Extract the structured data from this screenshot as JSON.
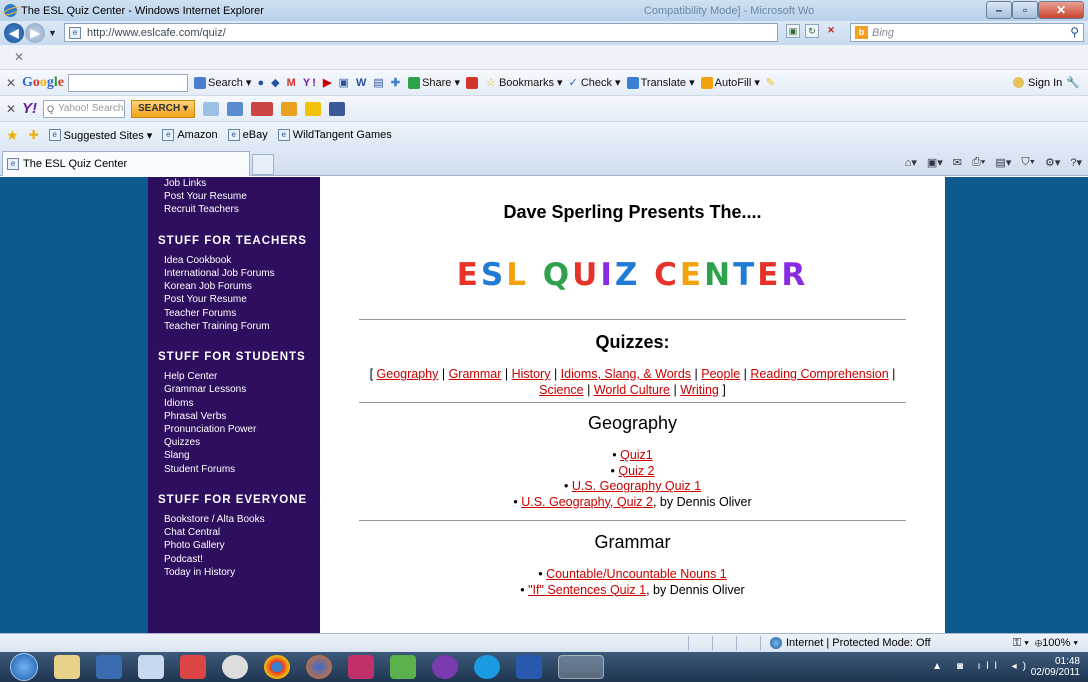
{
  "window": {
    "title": "The ESL Quiz Center - Windows Internet Explorer",
    "ghost_title": "Compatibility Mode] - Microsoft Wo"
  },
  "address": {
    "url": "http://www.eslcafe.com/quiz/",
    "search_placeholder": "Bing"
  },
  "google_toolbar": {
    "logo": [
      "G",
      "o",
      "o",
      "g",
      "l",
      "e"
    ],
    "items": [
      "Search ▾",
      "Share ▾",
      "Bookmarks ▾",
      "Check ▾",
      "Translate ▾",
      "AutoFill ▾"
    ],
    "sign_in": "Sign In"
  },
  "yahoo_toolbar": {
    "logo": "Y!",
    "search_placeholder": "Yahoo! Search",
    "search_button": "SEARCH ▾"
  },
  "favorites": {
    "items": [
      "Suggested Sites ▾",
      "Amazon",
      "eBay",
      "WildTangent Games"
    ]
  },
  "tab": {
    "label": "The ESL Quiz Center"
  },
  "sidebar": {
    "top_links": [
      "Job Links",
      "Post Your Resume",
      "Recruit Teachers"
    ],
    "sections": [
      {
        "title": "STUFF FOR TEACHERS",
        "links": [
          "Idea Cookbook",
          "International Job Forums",
          "Korean Job Forums",
          "Post Your Resume",
          "Teacher Forums",
          "Teacher Training Forum"
        ]
      },
      {
        "title": "STUFF FOR STUDENTS",
        "links": [
          "Help Center",
          "Grammar Lessons",
          "Idioms",
          "Phrasal Verbs",
          "Pronunciation Power",
          "Quizzes",
          "Slang",
          "Student Forums"
        ]
      },
      {
        "title": "STUFF FOR EVERYONE",
        "links": [
          "Bookstore / Alta Books",
          "Chat Central",
          "Photo Gallery",
          "Podcast!",
          "Today in History"
        ]
      }
    ]
  },
  "main": {
    "heading": "Dave Sperling Presents The....",
    "logo_letters": [
      "E",
      "S",
      "L",
      " ",
      "Q",
      "U",
      "I",
      "Z",
      " ",
      "C",
      "E",
      "N",
      "T",
      "E",
      "R"
    ],
    "logo_colors": [
      "#e6332a",
      "#1f7bd6",
      "#f2a20c",
      "#ffffff",
      "#2ea24a",
      "#e6332a",
      "#8a2be2",
      "#1f7bd6",
      "#ffffff",
      "#e6332a",
      "#f2a20c",
      "#2ea24a",
      "#1f7bd6",
      "#e6332a",
      "#8a2be2"
    ],
    "quizzes_title": "Quizzes:",
    "categories": [
      "Geography",
      "Grammar",
      "History",
      "Idioms, Slang, & Words",
      "People",
      "Reading Comprehension",
      "Science",
      "World Culture",
      "Writing"
    ],
    "geography_title": "Geography",
    "geography_items": [
      {
        "link": "Quiz1",
        "suffix": ""
      },
      {
        "link": "Quiz 2",
        "suffix": ""
      },
      {
        "link": "U.S. Geography Quiz 1",
        "suffix": ""
      },
      {
        "link": "U.S. Geography, Quiz 2",
        "suffix": ", by Dennis Oliver"
      }
    ],
    "grammar_title": "Grammar",
    "grammar_items": [
      {
        "link": "Countable/Uncountable Nouns 1",
        "suffix": ""
      },
      {
        "link": "\"If\" Sentences Quiz 1",
        "suffix": ", by Dennis Oliver"
      }
    ]
  },
  "status": {
    "zone": "Internet | Protected Mode: Off",
    "zoom": "100%"
  },
  "taskbar": {
    "time": "01:48",
    "date": "02/09/2011"
  }
}
